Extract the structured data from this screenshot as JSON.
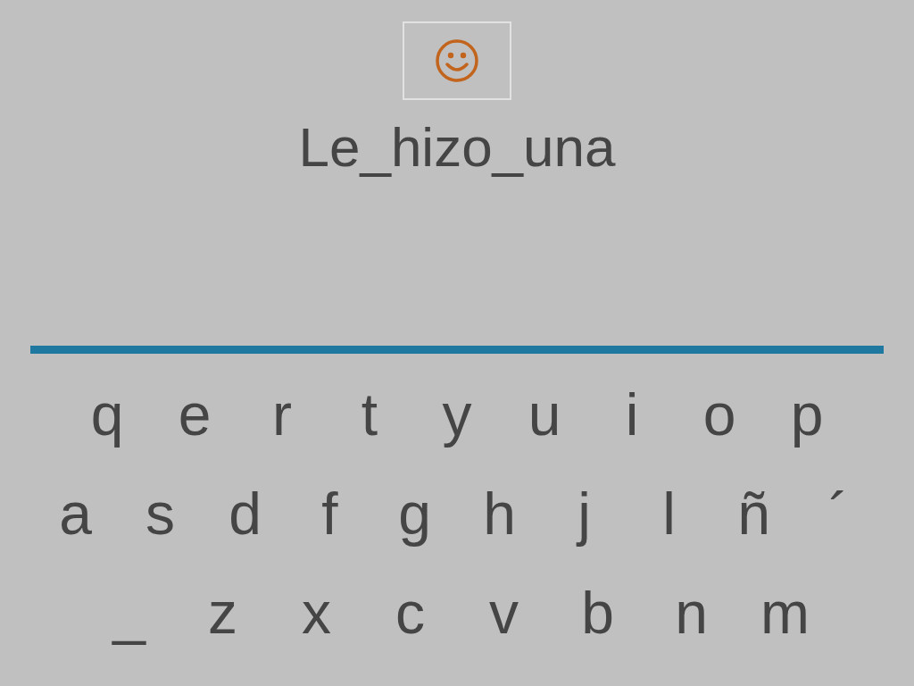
{
  "answer": "Le_hizo_una",
  "keyboard": {
    "rows": [
      [
        "q",
        "e",
        "r",
        "t",
        "y",
        "u",
        "i",
        "o",
        "p"
      ],
      [
        "a",
        "s",
        "d",
        "f",
        "g",
        "h",
        "j",
        "l",
        "ñ",
        "´"
      ],
      [
        "_",
        "z",
        "x",
        "c",
        "v",
        "b",
        "n",
        "m"
      ]
    ]
  }
}
